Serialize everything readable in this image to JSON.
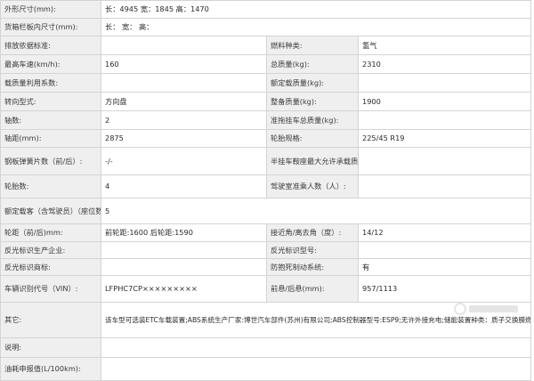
{
  "rows": [
    {
      "l1": "外形尺寸(mm):",
      "v1": "长：4945 宽：1845 高：1470"
    },
    {
      "l1": "货箱栏板内尺寸(mm):",
      "v1": "长： 宽： 高："
    },
    {
      "l1": "排放依据标准:",
      "v1": "",
      "l2": "燃料种类:",
      "v2": "氢气"
    },
    {
      "l1": "最高车速(km/h):",
      "v1": "160",
      "l2": "总质量(kg):",
      "v2": "2310"
    },
    {
      "l1": "载质量利用系数:",
      "v1": "",
      "l2": "额定载质量(kg):",
      "v2": ""
    },
    {
      "l1": "转向型式:",
      "v1": "方向盘",
      "l2": "整备质量(kg):",
      "v2": "1900"
    },
    {
      "l1": "轴数:",
      "v1": "2",
      "l2": "准拖挂车总质量(kg):",
      "v2": ""
    },
    {
      "l1": "轴距(mm):",
      "v1": "2875",
      "l2": "轮胎规格:",
      "v2": "225/45 R19"
    },
    {
      "l1": "钢板弹簧片数（前/后）:",
      "v1": "-/-",
      "l2": "半挂车鞍座最大允许承载质量(kg):",
      "v2": ""
    },
    {
      "l1": "轮胎数:",
      "v1": "4",
      "l2": "驾驶室准乘人数（人）:",
      "v2": ""
    },
    {
      "l1": "额定载客（含驾驶员）（座位数）:",
      "v1": "5"
    },
    {
      "l1": "轮距（前/后)mm:",
      "v1": "前轮距:1600 后轮距:1590",
      "l2": "接近角/离去角（度）:",
      "v2": "14/12"
    },
    {
      "l1": "反光标识生产企业:",
      "v1": "",
      "l2": "反光标识型号:",
      "v2": ""
    },
    {
      "l1": "反光标识商标:",
      "v1": "",
      "l2": "防抱死制动系统:",
      "v2": "有"
    },
    {
      "l1": "车辆识别代号（VIN）:",
      "v1": "LFPHC7CP×××××××××",
      "l2": "前悬/后悬(mm):",
      "v2": "957/1113"
    },
    {
      "l1": "其它:",
      "v1": "该车型可选装ETC车载装置;ABS系统生产厂家:博世汽车部件(苏州)有限公司;ABS控制器型号:ESP9;无许外接充电;储能装置种类：质子交换膜燃料电池/三元锂离子电池；储能装置生产企业:中国第一汽车集团有限公司;驱动电机额定功率60kW,峰值功率140kW."
    },
    {
      "l1": "说明:",
      "v1": ""
    },
    {
      "l1": "油耗申报值(L/100km):",
      "v1": ""
    }
  ]
}
